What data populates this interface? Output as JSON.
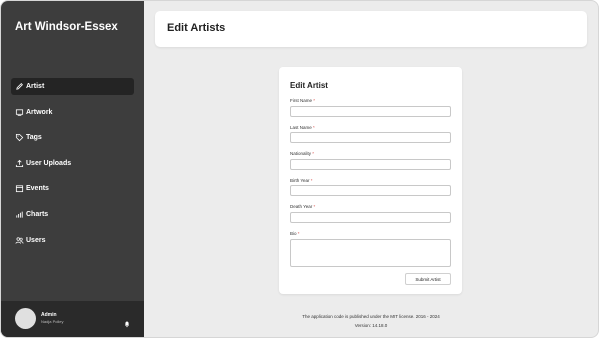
{
  "sidebar": {
    "brand": "Art Windsor-Essex",
    "items": [
      {
        "label": "Artist",
        "icon": "pencil-icon",
        "active": true
      },
      {
        "label": "Artwork",
        "icon": "frame-icon",
        "active": false
      },
      {
        "label": "Tags",
        "icon": "tag-icon",
        "active": false
      },
      {
        "label": "User Uploads",
        "icon": "upload-icon",
        "active": false
      },
      {
        "label": "Events",
        "icon": "calendar-icon",
        "active": false
      },
      {
        "label": "Charts",
        "icon": "bar-chart-icon",
        "active": false
      },
      {
        "label": "Users",
        "icon": "users-icon",
        "active": false
      }
    ],
    "user": {
      "name": "Admin",
      "subtitle": "Nadja Polley",
      "icon": "bell-icon"
    }
  },
  "header": {
    "title": "Edit Artists"
  },
  "form": {
    "title": "Edit Artist",
    "required_marker": "*",
    "fields": [
      {
        "label": "First Name",
        "value": ""
      },
      {
        "label": "Last Name",
        "value": ""
      },
      {
        "label": "Nationality",
        "value": ""
      },
      {
        "label": "Birth Year",
        "value": ""
      },
      {
        "label": "Death Year",
        "value": ""
      },
      {
        "label": "Bio",
        "value": ""
      }
    ],
    "submit_label": "Submit Artist"
  },
  "footer": {
    "license": "The application code is published under the MIT license. 2016 - 2024",
    "version": "Version: 14.18.0"
  },
  "colors": {
    "sidebar_bg": "#3d3d3d",
    "active_item_bg": "#242424",
    "page_bg": "#ececec",
    "required": "#d9534f"
  }
}
